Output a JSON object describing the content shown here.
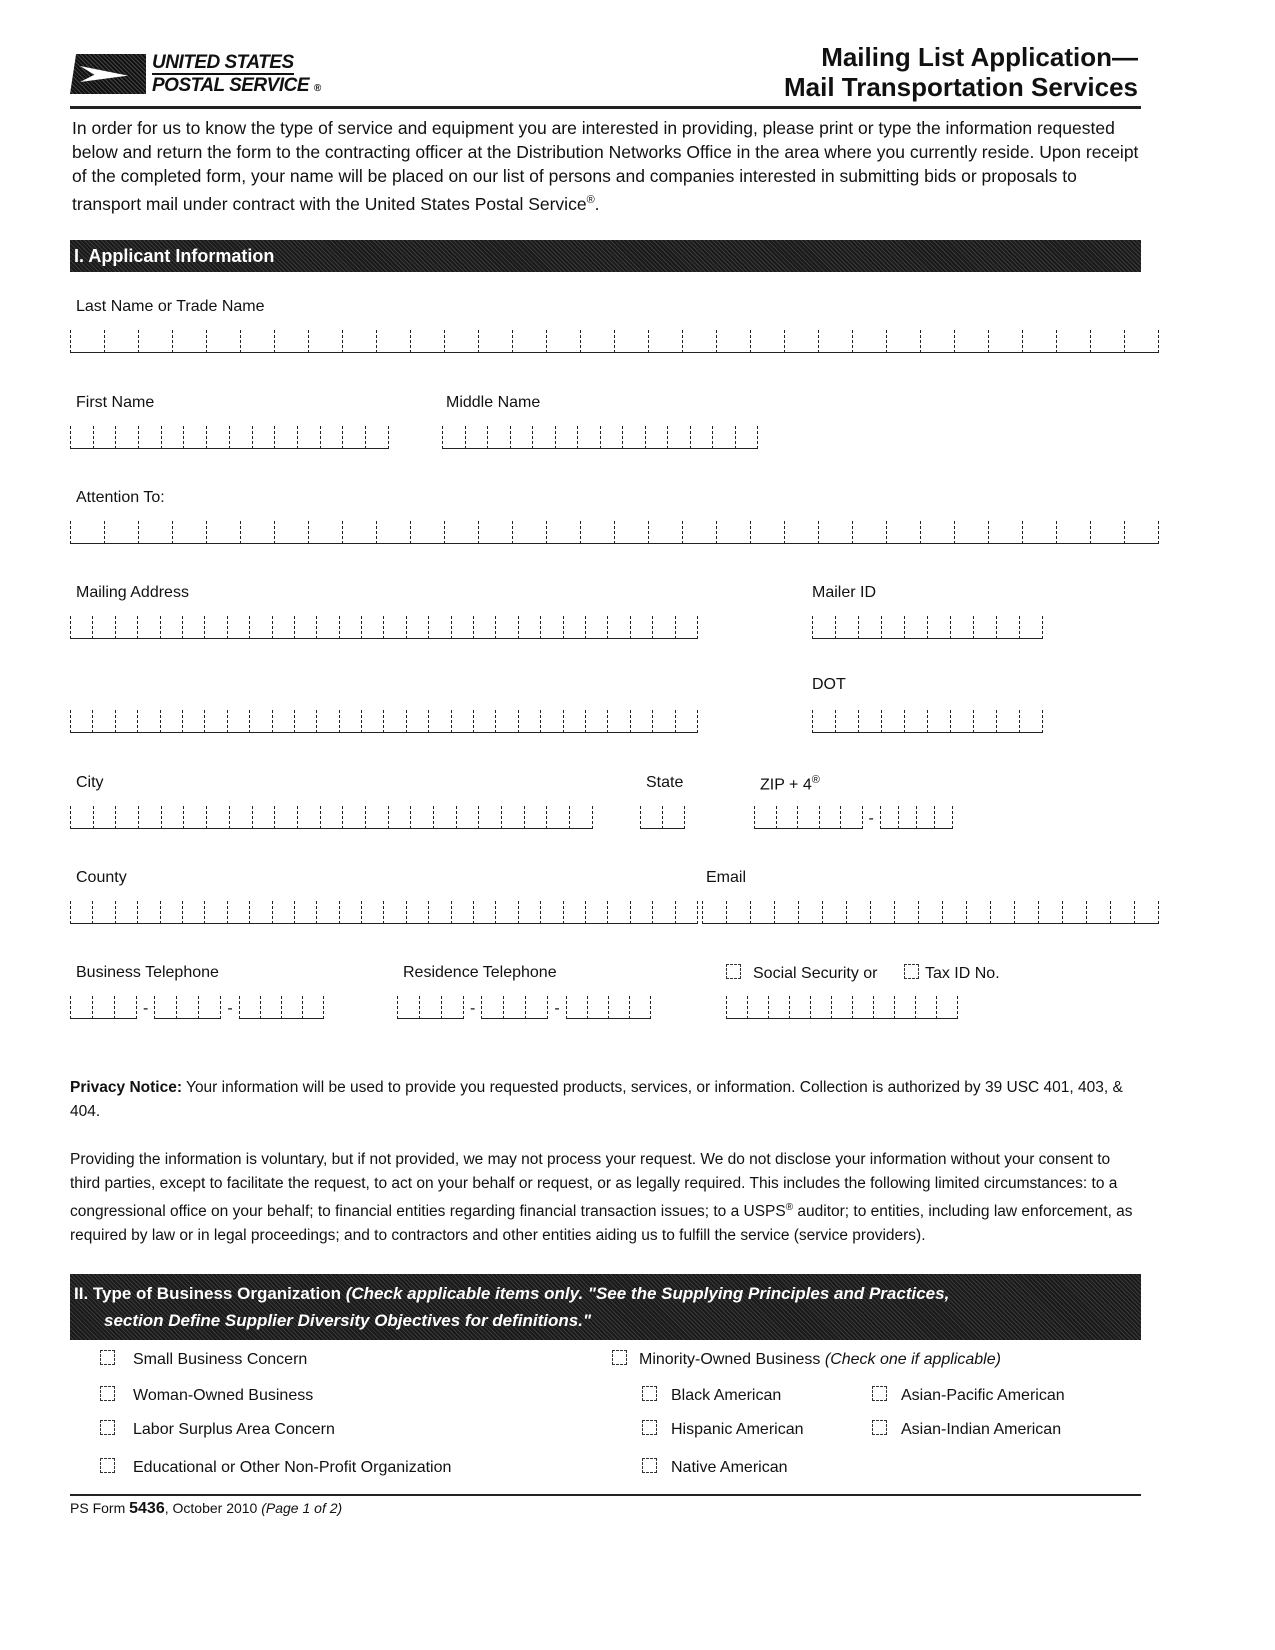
{
  "header": {
    "logo_line1": "UNITED STATES",
    "logo_line2": "POSTAL SERVICE",
    "logo_mark": "®",
    "title_line1": "Mailing List Application—",
    "title_line2": "Mail Transportation Services"
  },
  "intro": "In order for us to know the type of service and equipment you are interested in providing, please print or type the information requested below and return the form to the contracting officer at the Distribution Networks Office in the area where you currently reside. Upon receipt of the completed form, your name will be placed on our list of persons and companies interested in submitting bids or proposals to transport mail under contract with the United States Postal Service",
  "intro_reg": "®",
  "intro_end": ".",
  "section1": {
    "title": "I.  Applicant Information",
    "fields": {
      "last_name": {
        "label": "Last Name or Trade Name",
        "boxes": 32,
        "value": ""
      },
      "first_name": {
        "label": "First Name",
        "boxes": 14,
        "value": ""
      },
      "middle_name": {
        "label": "Middle Name",
        "boxes": 14,
        "value": ""
      },
      "attention": {
        "label": "Attention To:",
        "boxes": 32,
        "value": ""
      },
      "mailing_address": {
        "label": "Mailing Address",
        "boxes": 28,
        "value": ""
      },
      "mailing_address_2": {
        "boxes": 28,
        "value": ""
      },
      "mailer_id": {
        "label": "Mailer ID",
        "boxes": 10,
        "value": ""
      },
      "dot": {
        "label": "DOT",
        "boxes": 10,
        "value": ""
      },
      "city": {
        "label": "City",
        "boxes": 23,
        "value": ""
      },
      "state": {
        "label": "State",
        "boxes": 2,
        "value": ""
      },
      "zip": {
        "label": "ZIP + 4",
        "reg": "®",
        "boxes_main": 5,
        "boxes_ext": 4,
        "value": ""
      },
      "county": {
        "label": "County",
        "boxes": 28,
        "value": ""
      },
      "email": {
        "label": "Email",
        "boxes": 19,
        "value": ""
      },
      "business_phone": {
        "label": "Business Telephone",
        "value": ""
      },
      "residence_phone": {
        "label": "Residence Telephone",
        "value": ""
      },
      "ssn_label": "Social Security or",
      "taxid_label": "Tax ID No.",
      "ssn_tax": {
        "boxes": 11,
        "value": ""
      }
    }
  },
  "privacy": {
    "bold": "Privacy Notice:",
    "text1": " Your information will be used to provide you requested products, services, or information. Collection is authorized by 39 USC 401, 403, & 404.",
    "text2a": "Providing the information is voluntary, but if not provided, we may not process your request. We do not disclose your information without your consent to third parties, except to facilitate the request, to act on your behalf or request, or as legally required. This includes the following limited circumstances: to a congressional office on your behalf; to financial entities regarding financial transaction issues; to a USPS",
    "text2reg": "®",
    "text2b": " auditor; to entities, including law enforcement, as required by law or in legal proceedings; and to contractors and other entities aiding us to fulfill the service (service providers)."
  },
  "section2": {
    "title": "II.  Type of Business Organization",
    "title_italic": " (Check applicable items only. \"See the Supplying Principles and Practices,",
    "title_line2": "section Define Supplier Diversity Objectives for definitions.\"",
    "left_items": [
      {
        "label": "Small Business Concern",
        "checked": false
      },
      {
        "label": "Woman-Owned Business",
        "checked": false
      },
      {
        "label": "Labor Surplus Area Concern",
        "checked": false
      },
      {
        "label": "Educational or Other Non-Profit Organization",
        "checked": false
      }
    ],
    "minority": {
      "label": "Minority-Owned Business",
      "note": "(Check one if applicable)",
      "checked": false
    },
    "minority_items": [
      {
        "label": "Black American",
        "checked": false
      },
      {
        "label": "Asian-Pacific American",
        "checked": false
      },
      {
        "label": "Hispanic American",
        "checked": false
      },
      {
        "label": "Asian-Indian American",
        "checked": false
      },
      {
        "label": "Native American",
        "checked": false
      }
    ]
  },
  "footer": {
    "prefix": "PS Form ",
    "number": "5436",
    "date": ", October 2010 ",
    "page": "(Page 1 of 2)"
  }
}
